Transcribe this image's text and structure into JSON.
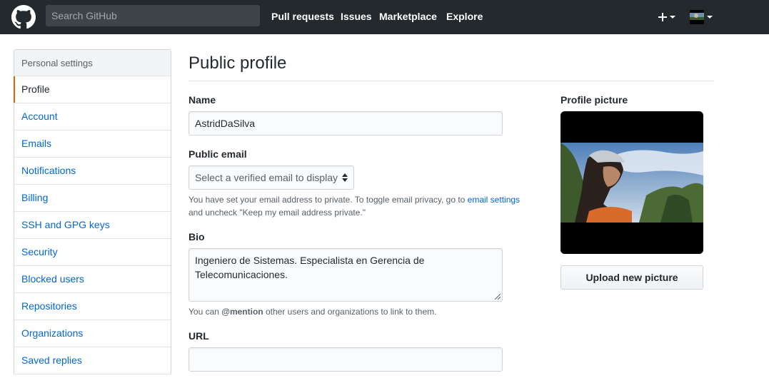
{
  "header": {
    "search_placeholder": "Search GitHub",
    "nav": [
      "Pull requests",
      "Issues",
      "Marketplace",
      "Explore"
    ],
    "plus_label": "+"
  },
  "sidebar": {
    "title": "Personal settings",
    "items": [
      {
        "label": "Profile",
        "selected": true
      },
      {
        "label": "Account"
      },
      {
        "label": "Emails"
      },
      {
        "label": "Notifications"
      },
      {
        "label": "Billing"
      },
      {
        "label": "SSH and GPG keys"
      },
      {
        "label": "Security"
      },
      {
        "label": "Blocked users"
      },
      {
        "label": "Repositories"
      },
      {
        "label": "Organizations"
      },
      {
        "label": "Saved replies"
      }
    ]
  },
  "main": {
    "title": "Public profile",
    "name": {
      "label": "Name",
      "value": "AstridDaSilva"
    },
    "public_email": {
      "label": "Public email",
      "selected": "Select a verified email to display",
      "note_prefix": "You have set your email address to private. To toggle email privacy, go to ",
      "note_link": "email settings",
      "note_suffix": "and uncheck \"Keep my email address private.\""
    },
    "bio": {
      "label": "Bio",
      "value": "Ingeniero de Sistemas. Especialista en Gerencia de Telecomunicaciones.",
      "note_prefix": "You can ",
      "note_mention": "@mention",
      "note_suffix": " other users and organizations to link to them."
    },
    "url": {
      "label": "URL",
      "value": ""
    }
  },
  "profile_picture": {
    "label": "Profile picture",
    "upload_label": "Upload new picture"
  },
  "colors": {
    "header_bg": "#24292e",
    "link": "#0366d6",
    "selected_accent": "#e36209"
  }
}
